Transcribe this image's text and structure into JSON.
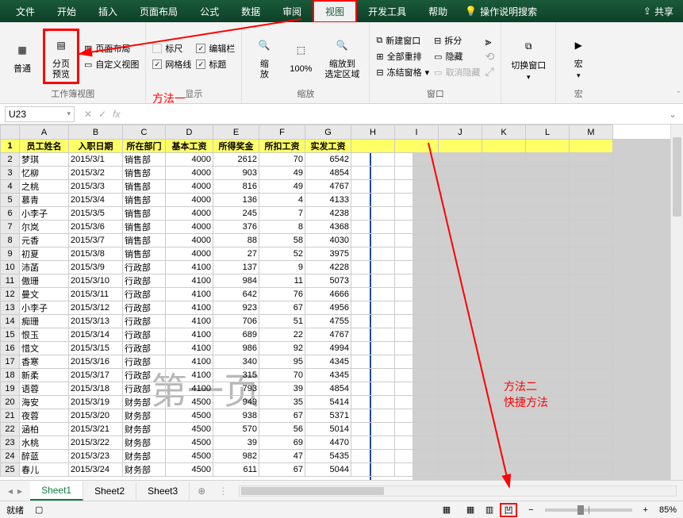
{
  "menu": {
    "file": "文件",
    "home": "开始",
    "insert": "插入",
    "layout": "页面布局",
    "formula": "公式",
    "data": "数据",
    "review": "审阅",
    "view": "视图",
    "dev": "开发工具",
    "help": "帮助",
    "search": "操作说明搜索",
    "share": "共享"
  },
  "ribbon": {
    "normal": "普通",
    "page_break": "分页\n预览",
    "page_layout": "页面布局",
    "custom_view": "自定义视图",
    "group_view": "工作簿视图",
    "ruler": "标尺",
    "formula_bar_chk": "编辑栏",
    "gridlines": "网格线",
    "headings": "标题",
    "group_show": "显示",
    "zoom": "缩\n放",
    "zoom100": "100%",
    "zoom_sel": "缩放到\n选定区域",
    "group_zoom": "缩放",
    "new_win": "新建窗口",
    "arrange": "全部重排",
    "freeze": "冻结窗格",
    "split": "拆分",
    "hide": "隐藏",
    "unhide": "取消隐藏",
    "group_win": "窗口",
    "switch_win": "切换窗口",
    "macro": "宏",
    "group_macro": "宏"
  },
  "annotations": {
    "method1": "方法一",
    "method2a": "方法二",
    "method2b": "快捷方法"
  },
  "name_box": "U23",
  "columns": [
    "A",
    "B",
    "C",
    "D",
    "E",
    "F",
    "G",
    "H",
    "I",
    "J",
    "K",
    "L",
    "M"
  ],
  "header_row": [
    "员工姓名",
    "入职日期",
    "所在部门",
    "基本工资",
    "所得奖金",
    "所扣工资",
    "实发工资"
  ],
  "rows": [
    [
      "梦琪",
      "2015/3/1",
      "销售部",
      "4000",
      "2612",
      "70",
      "6542"
    ],
    [
      "忆柳",
      "2015/3/2",
      "销售部",
      "4000",
      "903",
      "49",
      "4854"
    ],
    [
      "之桃",
      "2015/3/3",
      "销售部",
      "4000",
      "816",
      "49",
      "4767"
    ],
    [
      "慕青",
      "2015/3/4",
      "销售部",
      "4000",
      "136",
      "4",
      "4133"
    ],
    [
      "小李子",
      "2015/3/5",
      "销售部",
      "4000",
      "245",
      "7",
      "4238"
    ],
    [
      "尔岚",
      "2015/3/6",
      "销售部",
      "4000",
      "376",
      "8",
      "4368"
    ],
    [
      "元香",
      "2015/3/7",
      "销售部",
      "4000",
      "88",
      "58",
      "4030"
    ],
    [
      "初夏",
      "2015/3/8",
      "销售部",
      "4000",
      "27",
      "52",
      "3975"
    ],
    [
      "沛菡",
      "2015/3/9",
      "行政部",
      "4100",
      "137",
      "9",
      "4228"
    ],
    [
      "傲珊",
      "2015/3/10",
      "行政部",
      "4100",
      "984",
      "11",
      "5073"
    ],
    [
      "曼文",
      "2015/3/11",
      "行政部",
      "4100",
      "642",
      "76",
      "4666"
    ],
    [
      "小李子",
      "2015/3/12",
      "行政部",
      "4100",
      "923",
      "67",
      "4956"
    ],
    [
      "痴珊",
      "2015/3/13",
      "行政部",
      "4100",
      "706",
      "51",
      "4755"
    ],
    [
      "恨玉",
      "2015/3/14",
      "行政部",
      "4100",
      "689",
      "22",
      "4767"
    ],
    [
      "惜文",
      "2015/3/15",
      "行政部",
      "4100",
      "986",
      "92",
      "4994"
    ],
    [
      "香寒",
      "2015/3/16",
      "行政部",
      "4100",
      "340",
      "95",
      "4345"
    ],
    [
      "新柔",
      "2015/3/17",
      "行政部",
      "4100",
      "315",
      "70",
      "4345"
    ],
    [
      "语蓉",
      "2015/3/18",
      "行政部",
      "4100",
      "793",
      "39",
      "4854"
    ],
    [
      "海安",
      "2015/3/19",
      "财务部",
      "4500",
      "949",
      "35",
      "5414"
    ],
    [
      "夜蓉",
      "2015/3/20",
      "财务部",
      "4500",
      "938",
      "67",
      "5371"
    ],
    [
      "涵柏",
      "2015/3/21",
      "财务部",
      "4500",
      "570",
      "56",
      "5014"
    ],
    [
      "水桃",
      "2015/3/22",
      "财务部",
      "4500",
      "39",
      "69",
      "4470"
    ],
    [
      "醉蓝",
      "2015/3/23",
      "财务部",
      "4500",
      "982",
      "47",
      "5435"
    ],
    [
      "春儿",
      "2015/3/24",
      "财务部",
      "4500",
      "611",
      "67",
      "5044"
    ]
  ],
  "watermark": "第一页",
  "tabs": {
    "s1": "Sheet1",
    "s2": "Sheet2",
    "s3": "Sheet3"
  },
  "status": {
    "ready": "就绪",
    "zoom": "85%"
  }
}
